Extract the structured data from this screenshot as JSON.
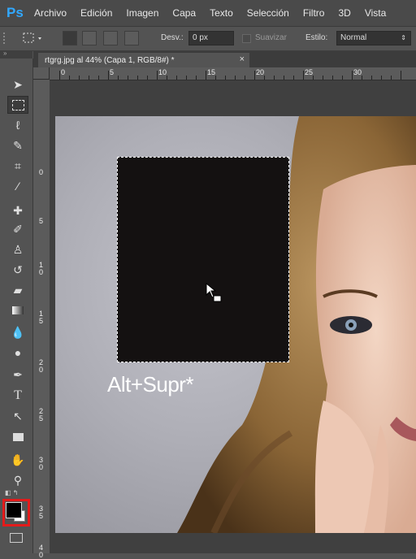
{
  "app": {
    "logo": "Ps"
  },
  "menu": [
    "Archivo",
    "Edición",
    "Imagen",
    "Capa",
    "Texto",
    "Selección",
    "Filtro",
    "3D",
    "Vista"
  ],
  "options": {
    "feather_label": "Desv.:",
    "feather_value": "0 px",
    "antialias_label": "Suavizar",
    "style_label": "Estilo:",
    "style_value": "Normal"
  },
  "document": {
    "tab_title": "rtgrg.jpg al 44% (Capa 1, RGB/8#) *",
    "close_glyph": "×"
  },
  "rulers": {
    "top": [
      "0",
      "5",
      "10",
      "15",
      "20",
      "25",
      "30"
    ],
    "left": [
      "0",
      "5",
      "1\n0",
      "1\n5",
      "2\n0",
      "2\n5",
      "3\n0",
      "3\n5",
      "4\n0"
    ]
  },
  "canvas": {
    "shortcut_text": "Alt+Supr*",
    "selection_fill": "#141111"
  },
  "colors": {
    "foreground": "#000000",
    "background": "#ffffff",
    "highlight": "#e31b1b"
  },
  "tools": [
    "move-icon",
    "marquee-icon",
    "lasso-icon",
    "quick-select-icon",
    "crop-icon",
    "eyedropper-icon",
    "healing-icon",
    "brush-icon",
    "stamp-icon",
    "history-brush-icon",
    "eraser-icon",
    "gradient-icon",
    "blur-icon",
    "dodge-icon",
    "pen-icon",
    "type-icon",
    "path-select-icon",
    "rectangle-icon",
    "hand-icon",
    "zoom-icon"
  ]
}
